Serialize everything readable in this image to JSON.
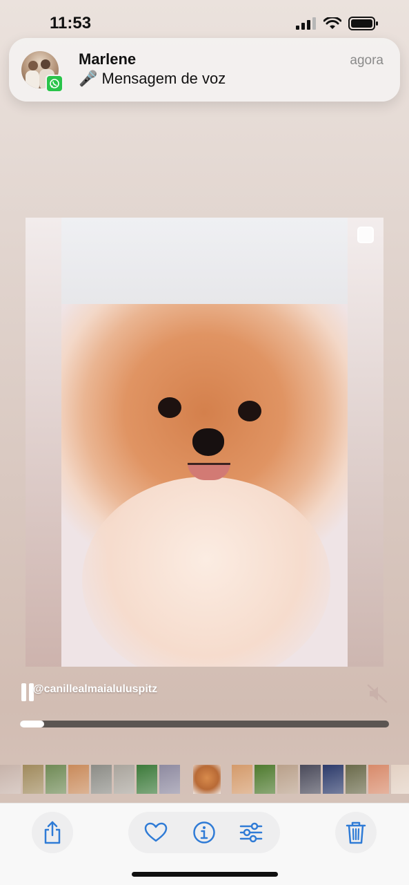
{
  "status_bar": {
    "time": "11:53",
    "icons": [
      "cellular-signal-icon",
      "wifi-icon",
      "battery-icon"
    ]
  },
  "notification": {
    "app_icon": "whatsapp-icon",
    "sender": "Marlene",
    "message": "🎤 Mensagem de voz",
    "time": "agora"
  },
  "media": {
    "caption": "@canillealmaialuluspitz",
    "muted": true,
    "playing": true,
    "progress": 0.065
  },
  "thumbnails": {
    "colors": [
      "#c7b3aa",
      "#a08a5c",
      "#6f8a55",
      "#c98a5a",
      "#8c8c86",
      "#a9a49c",
      "#3c7a3a",
      "#8e8aa0",
      "#d49a6a",
      "#4e7a2e",
      "#b9a08a",
      "#4a4a5a",
      "#2c3a6a",
      "#6a6a4a",
      "#d88a6a",
      "#e3d1c3",
      "#c8b8aa"
    ],
    "selected_color": "#d88b4c"
  },
  "toolbar": {
    "buttons": [
      "share-icon",
      "heart-icon",
      "info-icon",
      "adjust-icon",
      "trash-icon"
    ]
  },
  "colors": {
    "accent": "#2f7bd6",
    "whatsapp": "#29c44a"
  }
}
